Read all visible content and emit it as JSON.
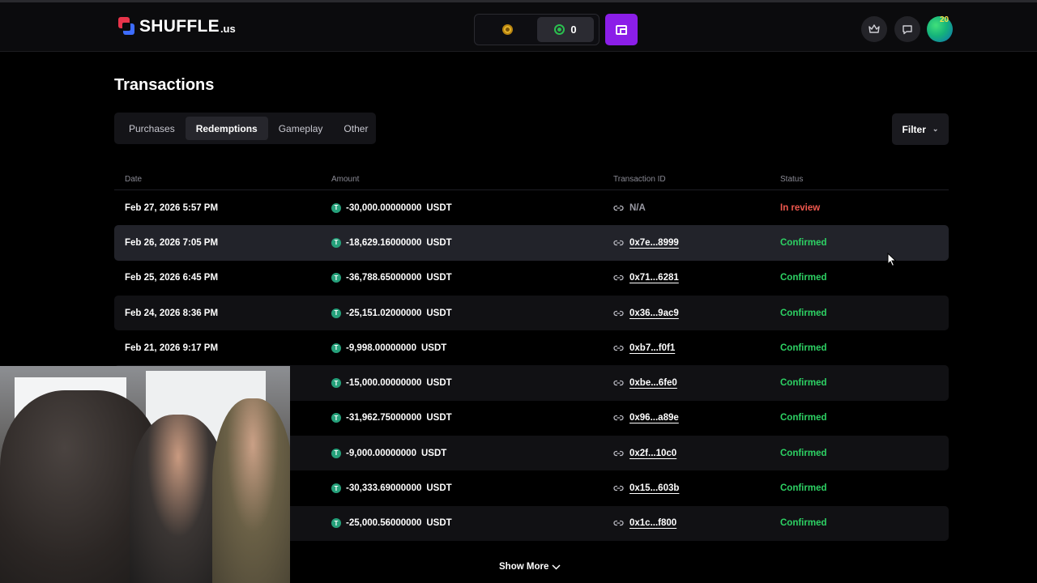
{
  "header": {
    "logo_text": "SHUFFLE",
    "logo_suffix": ".us",
    "balance_value": "0",
    "avatar_badge": "20"
  },
  "page": {
    "title": "Transactions"
  },
  "tabs": [
    {
      "label": "Purchases"
    },
    {
      "label": "Redemptions"
    },
    {
      "label": "Gameplay"
    },
    {
      "label": "Other"
    }
  ],
  "filter_label": "Filter",
  "table": {
    "headers": {
      "date": "Date",
      "amount": "Amount",
      "tx": "Transaction ID",
      "status": "Status"
    },
    "rows": [
      {
        "date": "Feb 27, 2026 5:57 PM",
        "amount": "-30,000.00000000",
        "currency": "USDT",
        "tx": "N/A",
        "status": "In review"
      },
      {
        "date": "Feb 26, 2026 7:05 PM",
        "amount": "-18,629.16000000",
        "currency": "USDT",
        "tx": "0x7e...8999",
        "status": "Confirmed"
      },
      {
        "date": "Feb 25, 2026 6:45 PM",
        "amount": "-36,788.65000000",
        "currency": "USDT",
        "tx": "0x71...6281",
        "status": "Confirmed"
      },
      {
        "date": "Feb 24, 2026 8:36 PM",
        "amount": "-25,151.02000000",
        "currency": "USDT",
        "tx": "0x36...9ac9",
        "status": "Confirmed"
      },
      {
        "date": "Feb 21, 2026 9:17 PM",
        "amount": "-9,998.00000000",
        "currency": "USDT",
        "tx": "0xb7...f0f1",
        "status": "Confirmed"
      },
      {
        "date": "",
        "amount": "-15,000.00000000",
        "currency": "USDT",
        "tx": "0xbe...6fe0",
        "status": "Confirmed"
      },
      {
        "date": "",
        "amount": "-31,962.75000000",
        "currency": "USDT",
        "tx": "0x96...a89e",
        "status": "Confirmed"
      },
      {
        "date": "",
        "amount": "-9,000.00000000",
        "currency": "USDT",
        "tx": "0x2f...10c0",
        "status": "Confirmed"
      },
      {
        "date": "",
        "amount": "-30,333.69000000",
        "currency": "USDT",
        "tx": "0x15...603b",
        "status": "Confirmed"
      },
      {
        "date": "",
        "amount": "-25,000.56000000",
        "currency": "USDT",
        "tx": "0x1c...f800",
        "status": "Confirmed"
      }
    ]
  },
  "show_more_label": "Show More",
  "colors": {
    "accent": "#8b1ee8",
    "confirmed": "#2dd264",
    "in_review": "#f0584e",
    "tether": "#26a17b"
  },
  "icons": {
    "gold_coin": "gold-coin-icon",
    "green_coin": "green-coin-icon",
    "wallet": "wallet-icon",
    "crown": "crown-icon",
    "chat": "chat-icon",
    "link": "link-icon",
    "tether": "tether-icon"
  }
}
